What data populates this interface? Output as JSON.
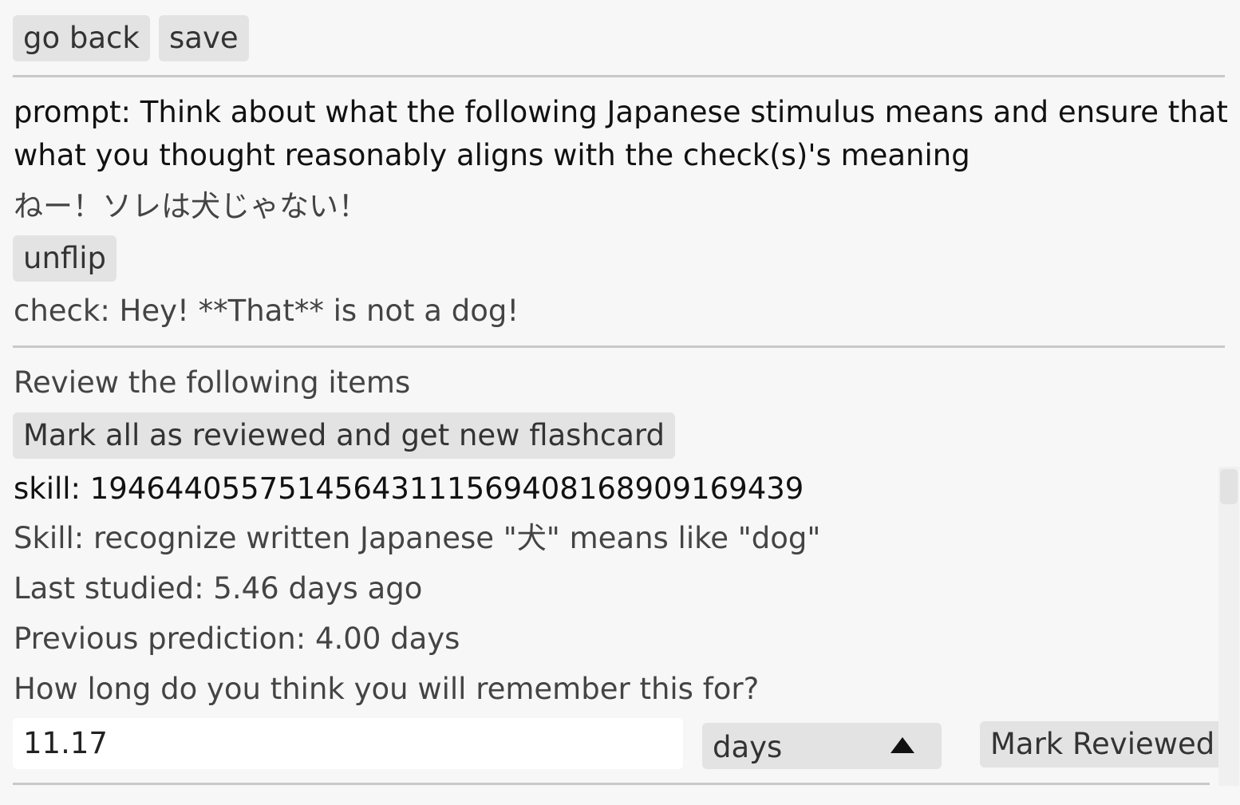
{
  "toolbar": {
    "go_back_label": "go back",
    "save_label": "save"
  },
  "card": {
    "prompt_line1": "prompt: Think about what the following Japanese stimulus means and ensure that",
    "prompt_line2": "what you thought reasonably aligns with the check(s)'s meaning",
    "stimulus": "ねー！ソレは犬じゃない！",
    "unflip_label": "unflip",
    "check": "check: Hey! **That** is not a dog!"
  },
  "review": {
    "heading": "Review the following items",
    "mark_all_label": "Mark all as reviewed and get new flashcard",
    "items": [
      {
        "skill_id": "skill: 19464405575145643111569408168909169439",
        "skill_desc": "Skill: recognize written Japanese \"犬\" means like \"dog\"",
        "last_studied": "Last studied: 5.46 days ago",
        "previous_prediction": "Previous prediction: 4.00 days",
        "question": "How long do you think you will remember this for?",
        "input_value": "11.17",
        "unit_selected": "days",
        "mark_reviewed_label": "Mark Reviewed"
      }
    ]
  },
  "icons": {
    "unit_select_caret": "triangle-up-icon"
  }
}
